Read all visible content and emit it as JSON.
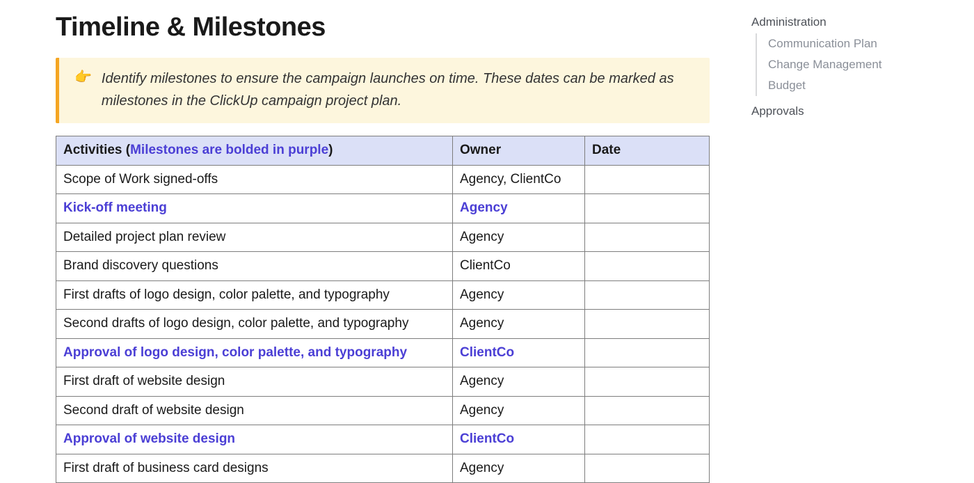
{
  "heading": "Timeline & Milestones",
  "callout": {
    "emoji": "👉",
    "text": "Identify milestones to ensure the campaign launches on time. These dates can be marked as milestones in the ClickUp campaign project plan."
  },
  "colors": {
    "milestone_purple": "#4b3fd5",
    "callout_bg": "#fdf6dd",
    "callout_accent": "#f5a623",
    "table_header_bg": "#dbe0f7"
  },
  "table": {
    "header": {
      "activities_prefix": "Activities (",
      "activities_highlight": "Milestones are bolded in purple",
      "activities_suffix": ")",
      "owner": "Owner",
      "date": "Date"
    },
    "rows": [
      {
        "activity": "Scope of Work signed-offs",
        "owner": "Agency, ClientCo",
        "date": "",
        "milestone": false
      },
      {
        "activity": "Kick-off meeting",
        "owner": "Agency",
        "date": "",
        "milestone": true
      },
      {
        "activity": "Detailed project plan review",
        "owner": "Agency",
        "date": "",
        "milestone": false
      },
      {
        "activity": "Brand discovery questions",
        "owner": "ClientCo",
        "date": "",
        "milestone": false
      },
      {
        "activity": "First drafts of logo design, color palette, and typography",
        "owner": "Agency",
        "date": "",
        "milestone": false
      },
      {
        "activity": "Second drafts of logo design, color palette, and typography",
        "owner": "Agency",
        "date": "",
        "milestone": false
      },
      {
        "activity": "Approval of logo design, color palette, and typography",
        "owner": "ClientCo",
        "date": "",
        "milestone": true
      },
      {
        "activity": "First draft of website design",
        "owner": "Agency",
        "date": "",
        "milestone": false
      },
      {
        "activity": "Second draft of website design",
        "owner": "Agency",
        "date": "",
        "milestone": false
      },
      {
        "activity": "Approval of website design",
        "owner": "ClientCo",
        "date": "",
        "milestone": true
      },
      {
        "activity": "First draft of business card designs",
        "owner": "Agency",
        "date": "",
        "milestone": false
      }
    ]
  },
  "sidebar": {
    "sections": [
      {
        "title": "Administration",
        "items": [
          {
            "label": "Communication Plan"
          },
          {
            "label": "Change Management"
          },
          {
            "label": "Budget"
          }
        ]
      },
      {
        "title": "Approvals",
        "items": []
      }
    ]
  }
}
